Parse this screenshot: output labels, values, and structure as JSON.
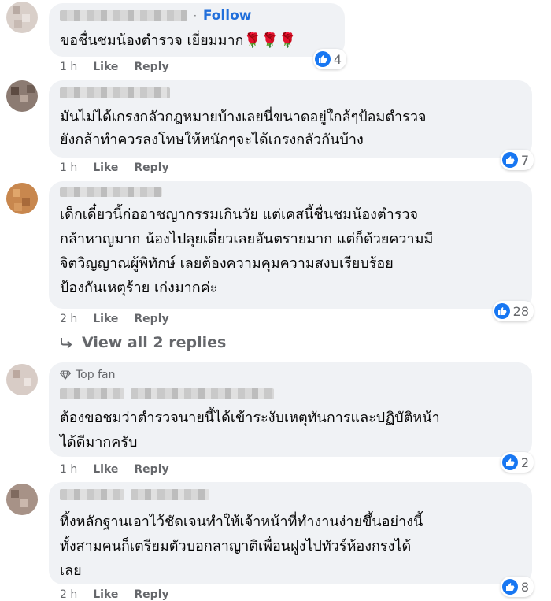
{
  "comments": [
    {
      "follow_label": "Follow",
      "text_lines": [
        "ขอชื่นชมน้องตำรวจ เยี่ยมมาก🌹🌹🌹"
      ],
      "time": "1 h",
      "like_label": "Like",
      "reply_label": "Reply",
      "reaction_count": "4"
    },
    {
      "text_lines": [
        "มันไม่ได้เกรงกลัวกฎหมายบ้างเลยนี่ขนาดอยู่ใกล้ๆป้อมตำรวจ",
        "ยังกล้าทำควรลงโทษให้หนักๆจะได้เกรงกลัวกันบ้าง"
      ],
      "time": "1 h",
      "like_label": "Like",
      "reply_label": "Reply",
      "reaction_count": "7"
    },
    {
      "text_lines": [
        "เด็กเดี๋ยวนี้ก่ออาชญากรรมเกินวัย แต่เคสนี้ชื่นชมน้องตำรวจ",
        "กล้าหาญมาก น้องไปลุยเดี่ยวเลยอันตรายมาก แต่ก็ด้วยความมี",
        "จิตวิญญาณผู้พิทักษ์ เลยต้องความคุมความสงบเรียบร้อย",
        "ป้องกันเหตุร้าย เก่งมากค่ะ"
      ],
      "time": "2 h",
      "like_label": "Like",
      "reply_label": "Reply",
      "reaction_count": "28",
      "view_replies": "View all 2 replies"
    },
    {
      "badge": "Top fan",
      "text_lines": [
        "ต้องขอชมว่าตำรวจนายนี้ได้เข้าระงับเหตุทันการและปฏิบัติหน้า",
        "ได้ดีมากครับ"
      ],
      "time": "1 h",
      "like_label": "Like",
      "reply_label": "Reply",
      "reaction_count": "2"
    },
    {
      "text_lines": [
        "ทิ้งหลักฐานเอาไว้ชัดเจนทำให้เจ้าหน้าที่ทำงานง่ายขึ้นอย่างนี้",
        "ทั้งสามคนก็เตรียมตัวบอกลาญาติเพื่อนฝูงไปทัวร์ห้องกรงได้",
        "เลย"
      ],
      "time": "2 h",
      "like_label": "Like",
      "reply_label": "Reply",
      "reaction_count": "8"
    }
  ],
  "icons": {
    "like": "thumbs-up-icon",
    "reply_arrow": "reply-arrow-icon",
    "top_fan": "diamond-icon"
  },
  "colors": {
    "bubble": "#f0f2f5",
    "link": "#216fdb",
    "like_blue": "#1877f2",
    "meta": "#65676b"
  }
}
